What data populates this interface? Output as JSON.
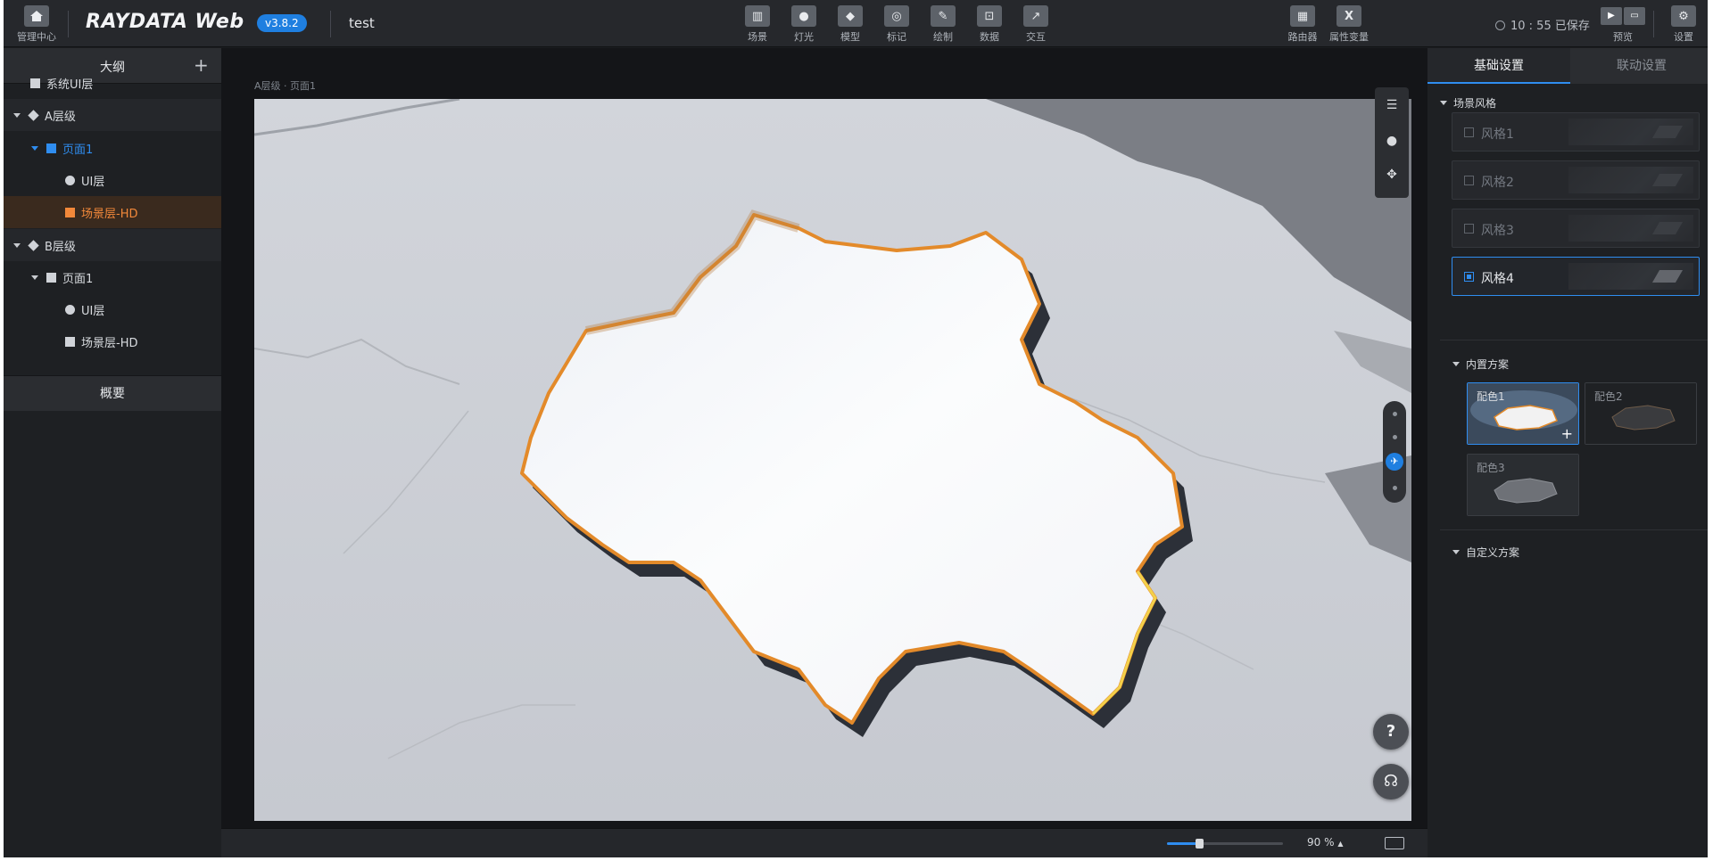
{
  "topbar": {
    "home_label": "管理中心",
    "logo_text": "RAYDATA Web",
    "version": "v3.8.2",
    "project_name": "test",
    "tools": [
      {
        "label": "场景",
        "icon": "scene-icon"
      },
      {
        "label": "灯光",
        "icon": "light-icon"
      },
      {
        "label": "模型",
        "icon": "model-icon"
      },
      {
        "label": "标记",
        "icon": "marker-icon"
      },
      {
        "label": "绘制",
        "icon": "draw-icon"
      },
      {
        "label": "数据",
        "icon": "data-icon"
      },
      {
        "label": "交互",
        "icon": "interaction-icon"
      }
    ],
    "right_tools": [
      {
        "label": "路由器",
        "icon": "router-icon"
      },
      {
        "label": "属性变量",
        "icon": "variable-icon"
      }
    ],
    "save_status": "10 : 55 已保存",
    "preview_label": "预览",
    "settings_label": "设置"
  },
  "outline": {
    "title": "大纲",
    "add_symbol": "+",
    "summary_label": "概要",
    "tree": [
      {
        "label": "系统UI层",
        "level": 0,
        "kind": "system"
      },
      {
        "label": "A层级",
        "level": 0,
        "kind": "group"
      },
      {
        "label": "页面1",
        "level": 1,
        "kind": "page-selected"
      },
      {
        "label": "UI层",
        "level": 2,
        "kind": "ui"
      },
      {
        "label": "场景层-HD",
        "level": 2,
        "kind": "scene-selected"
      },
      {
        "label": "B层级",
        "level": 0,
        "kind": "group"
      },
      {
        "label": "页面1",
        "level": 1,
        "kind": "page"
      },
      {
        "label": "UI层",
        "level": 2,
        "kind": "ui"
      },
      {
        "label": "场景层-HD",
        "level": 2,
        "kind": "scene"
      }
    ]
  },
  "canvas": {
    "breadcrumb": "A层级 · 页面1",
    "zoom_percent": 90,
    "zoom_label": "90 %",
    "zoom_caret": "▲"
  },
  "right_panel": {
    "tabs": [
      "基础设置",
      "联动设置"
    ],
    "active_tab": 0,
    "scene_style_title": "场景风格",
    "styles": [
      "风格1",
      "风格2",
      "风格3",
      "风格4"
    ],
    "selected_style": 3,
    "builtin_scheme_title": "内置方案",
    "color_schemes": [
      "配色1",
      "配色2",
      "配色3"
    ],
    "selected_scheme": 0,
    "custom_scheme_title": "自定义方案"
  },
  "colors": {
    "accent": "#2f8df0",
    "scene_selected": "#f2883a",
    "map_edge": "#e38a2a"
  }
}
